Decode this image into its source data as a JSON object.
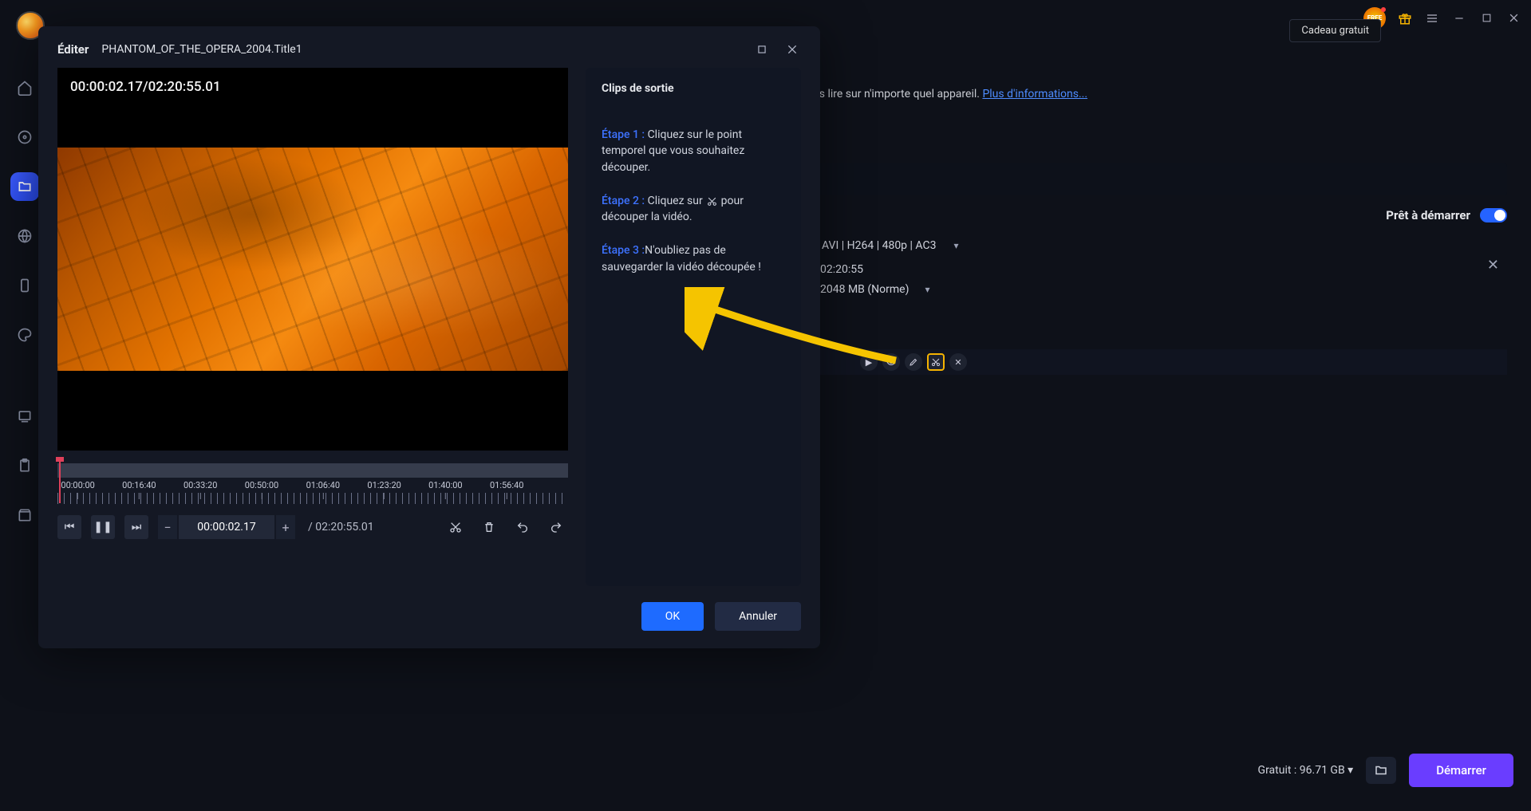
{
  "titlebar": {
    "free_badge": "FREE",
    "tooltip": "Cadeau gratuit"
  },
  "background": {
    "partial_text": "ur les lire sur n'importe quel appareil. ",
    "more_info": "Plus d'informations...",
    "ready_label": "Prêt à démarrer",
    "format_line": "AVI | H264 | 480p | AC3",
    "duration_line": "02:20:55",
    "size_line": "2048 MB (Norme)"
  },
  "footer": {
    "free_label": "Gratuit :",
    "free_space": "96.71 GB",
    "start": "Démarrer"
  },
  "modal": {
    "edit_label": "Éditer",
    "filename": "PHANTOM_OF_THE_OPERA_2004.Title1",
    "timecode_overlay": "00:00:02.17/02:20:55.01",
    "current_time": "00:00:02.17",
    "total_duration_slash": "/ 02:20:55.01",
    "ok": "OK",
    "cancel": "Annuler",
    "side_title": "Clips de sortie",
    "step1_label": "Étape 1 :",
    "step1_text": " Cliquez sur le point temporel que vous souhaitez découper.",
    "step2_label": "Étape 2 :",
    "step2_text_a": "Cliquez sur ",
    "step2_text_b": " pour découper la vidéo.",
    "step3_label": "Étape 3 :",
    "step3_text": "N'oubliez pas de sauvegarder la vidéo découpée !",
    "ticks": [
      "00:00:00",
      "00:16:40",
      "00:33:20",
      "00:50:00",
      "01:06:40",
      "01:23:20",
      "01:40:00",
      "01:56:40"
    ]
  }
}
